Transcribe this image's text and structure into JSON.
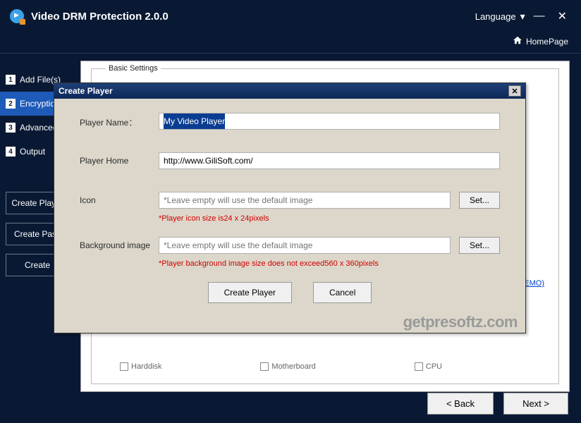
{
  "header": {
    "title": "Video DRM Protection 2.0.0",
    "language": "Language",
    "homepage": "HomePage"
  },
  "sidebar": {
    "steps": [
      {
        "num": "1",
        "label": "Add File(s)"
      },
      {
        "num": "2",
        "label": "Encryption"
      },
      {
        "num": "3",
        "label": "Advanced"
      },
      {
        "num": "4",
        "label": "Output"
      }
    ],
    "buttons": {
      "create_player": "Create Player",
      "create_pass": "Create Pass",
      "create": "Create"
    }
  },
  "main": {
    "fieldset_label": "Basic Settings",
    "demo_link": "of DEMO)",
    "hardware": {
      "harddisk": "Harddisk",
      "motherboard": "Motherboard",
      "cpu": "CPU"
    }
  },
  "modal": {
    "title": "Create Player",
    "labels": {
      "player_name": "Player Name：",
      "player_home": "Player Home",
      "icon": "Icon",
      "bg_image": "Background image"
    },
    "values": {
      "player_name": "My Video Player",
      "player_home": "http://www.GiliSoft.com/"
    },
    "placeholders": {
      "icon": "*Leave empty will use the default image",
      "bg_image": "*Leave empty will use the default image"
    },
    "hints": {
      "icon": "*Player icon size is24 x 24pixels",
      "bg": "*Player background image size does not exceed560 x 360pixels"
    },
    "buttons": {
      "set": "Set...",
      "create": "Create Player",
      "cancel": "Cancel"
    }
  },
  "footer": {
    "back": "<  Back",
    "next": "Next  >"
  },
  "watermark": "getpresoftz.com"
}
